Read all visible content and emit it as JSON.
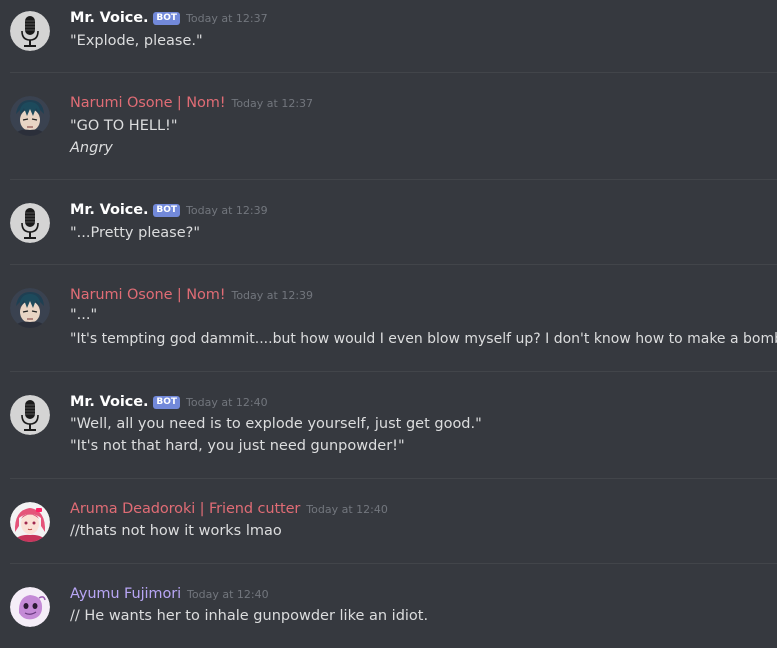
{
  "colors": {
    "background": "#36393f",
    "mr_voice_name": "#ffffff",
    "narumi_name": "#e06c75",
    "aruma_name": "#e06c75",
    "ayumu_name": "#b8a6f5",
    "bot_badge": "#7289da",
    "timestamp": "#72767d"
  },
  "messages": [
    {
      "author": "Mr. Voice.",
      "bot_tag": "BOT",
      "timestamp": "Today at 12:37",
      "avatar_icon": "microphone-icon",
      "lines": [
        "\"Explode, please.\""
      ]
    },
    {
      "author": "Narumi Osone | Nom!",
      "timestamp": "Today at 12:37",
      "avatar_icon": "anime-character-avatar",
      "lines": [
        "\"GO TO HELL!\"",
        "Angry"
      ]
    },
    {
      "author": "Mr. Voice.",
      "bot_tag": "BOT",
      "timestamp": "Today at 12:39",
      "avatar_icon": "microphone-icon",
      "lines": [
        "\"...Pretty please?\""
      ]
    },
    {
      "author": "Narumi Osone | Nom!",
      "timestamp": "Today at 12:39",
      "avatar_icon": "anime-character-avatar",
      "lines": [
        "\"...\"",
        "\"It's tempting god dammit....but how would I even blow myself up? I don't know how to make a bomb...\""
      ]
    },
    {
      "author": "Mr. Voice.",
      "bot_tag": "BOT",
      "timestamp": "Today at 12:40",
      "avatar_icon": "microphone-icon",
      "lines": [
        "\"Well, all you need is to explode yourself, just get good.\"",
        "\"It's not that hard, you just need gunpowder!\""
      ]
    },
    {
      "author": "Aruma Deadoroki | Friend cutter",
      "timestamp": "Today at 12:40",
      "avatar_icon": "pink-hair-character-avatar",
      "lines": [
        "//thats not how it works lmao"
      ]
    },
    {
      "author": "Ayumu Fujimori",
      "timestamp": "Today at 12:40",
      "avatar_icon": "purple-creature-avatar",
      "lines": [
        "// He wants her to inhale gunpowder like an idiot."
      ]
    }
  ]
}
